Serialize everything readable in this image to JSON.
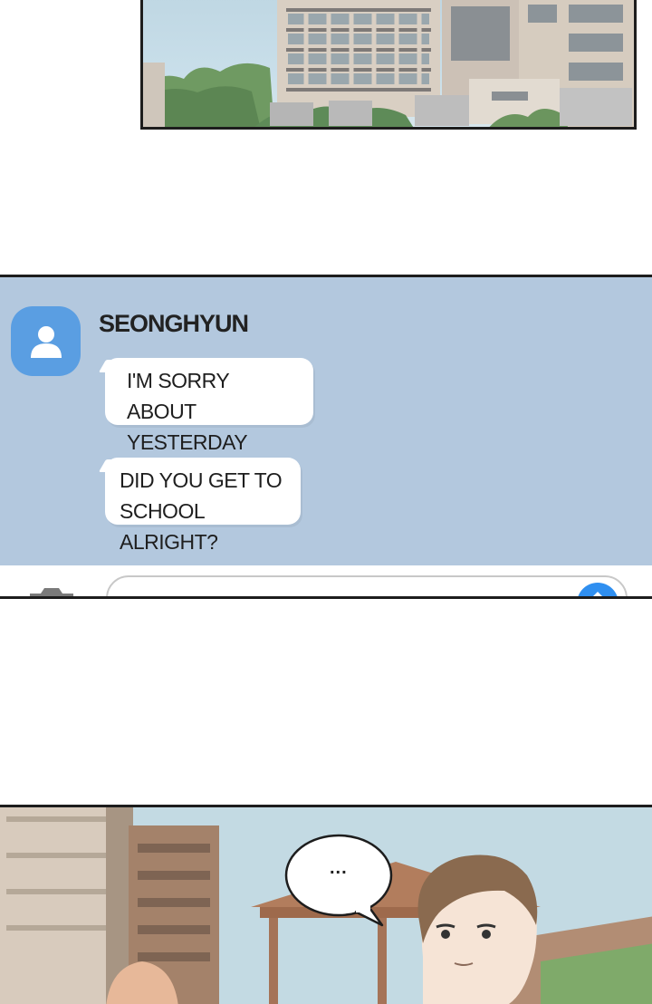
{
  "chat": {
    "sender_name": "SEONGHYUN",
    "messages": [
      {
        "line1": "I'M SORRY ABOUT",
        "line2": "YESTERDAY"
      },
      {
        "line1": "DID YOU GET TO",
        "line2": "SCHOOL ALRIGHT?"
      }
    ],
    "icons": {
      "avatar": "user-icon",
      "camera": "camera-icon",
      "send": "send-icon"
    },
    "colors": {
      "background": "#b3c8de",
      "avatar": "#5a9ee2",
      "send_button": "#2f8ff0"
    }
  },
  "scene": {
    "speech_bubble": "..."
  }
}
